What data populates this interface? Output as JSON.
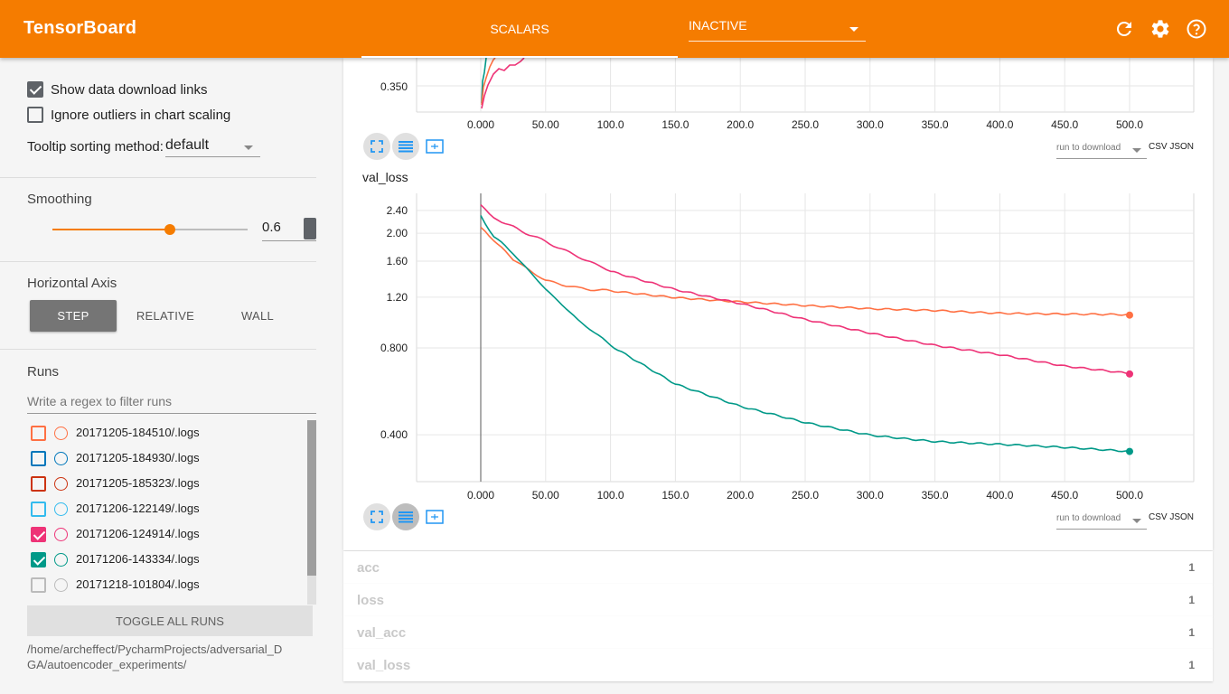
{
  "header": {
    "brand": "TensorBoard",
    "tab_scalars": "SCALARS",
    "inactive_select": "INACTIVE",
    "icons": [
      "refresh-icon",
      "gear-icon",
      "help-icon"
    ]
  },
  "sidebar": {
    "show_download_links": {
      "label": "Show data download links",
      "checked": true
    },
    "ignore_outliers": {
      "label": "Ignore outliers in chart scaling",
      "checked": false
    },
    "tooltip_sorting": {
      "label": "Tooltip sorting method:",
      "value": "default"
    },
    "smoothing": {
      "heading": "Smoothing",
      "value": "0.6",
      "fraction": 0.6
    },
    "horizontal_axis": {
      "heading": "Horizontal Axis",
      "options": [
        "STEP",
        "RELATIVE",
        "WALL"
      ],
      "selected": "STEP"
    },
    "runs": {
      "heading": "Runs",
      "filter_placeholder": "Write a regex to filter runs",
      "items": [
        {
          "name": "20171205-184510/.logs",
          "color": "#ff7043",
          "checked": false
        },
        {
          "name": "20171205-184930/.logs",
          "color": "#0077bb",
          "checked": false
        },
        {
          "name": "20171205-185323/.logs",
          "color": "#cc3311",
          "checked": false
        },
        {
          "name": "20171206-122149/.logs",
          "color": "#33bbee",
          "checked": false
        },
        {
          "name": "20171206-124914/.logs",
          "color": "#ee3377",
          "checked": true
        },
        {
          "name": "20171206-143334/.logs",
          "color": "#009988",
          "checked": true
        },
        {
          "name": "20171218-101804/.logs",
          "color": "#bbbbbb",
          "checked": false
        }
      ],
      "toggle_all": "TOGGLE ALL RUNS",
      "logdir": "/home/archeffect/PycharmProjects/adversarial_DGA/autoencoder_experiments/"
    }
  },
  "charts": {
    "top_partial": {
      "y_tick_visible": "0.350",
      "x_ticks": [
        "0.000",
        "50.00",
        "100.0",
        "150.0",
        "200.0",
        "250.0",
        "300.0",
        "350.0",
        "400.0",
        "450.0",
        "500.0"
      ]
    },
    "download": {
      "run_select_placeholder": "run to download",
      "formats": "CSV JSON"
    }
  },
  "chart_data": {
    "type": "line",
    "title": "val_loss",
    "xlim": [
      0,
      500
    ],
    "x_ticks": [
      "0.000",
      "50.00",
      "100.0",
      "150.0",
      "200.0",
      "250.0",
      "300.0",
      "350.0",
      "400.0",
      "450.0",
      "500.0"
    ],
    "y_ticks": [
      "0.400",
      "0.800",
      "1.20",
      "1.60",
      "2.00",
      "2.40"
    ],
    "y_scale": "log",
    "grid": true,
    "series": [
      {
        "color": "#ff7043",
        "x": [
          0,
          10,
          25,
          50,
          75,
          100,
          150,
          200,
          250,
          300,
          350,
          400,
          450,
          500
        ],
        "y": [
          2.1,
          1.9,
          1.62,
          1.37,
          1.29,
          1.26,
          1.2,
          1.16,
          1.12,
          1.09,
          1.08,
          1.06,
          1.05,
          1.04
        ]
      },
      {
        "color": "#ee3377",
        "x": [
          0,
          10,
          25,
          50,
          75,
          100,
          150,
          200,
          250,
          300,
          350,
          400,
          450,
          500
        ],
        "y": [
          2.5,
          2.25,
          2.1,
          1.87,
          1.66,
          1.48,
          1.28,
          1.14,
          1.0,
          0.9,
          0.82,
          0.76,
          0.69,
          0.65
        ]
      },
      {
        "color": "#009988",
        "x": [
          0,
          10,
          25,
          50,
          75,
          100,
          150,
          200,
          250,
          300,
          350,
          400,
          450,
          500
        ],
        "y": [
          2.3,
          1.95,
          1.7,
          1.28,
          1.0,
          0.82,
          0.6,
          0.5,
          0.44,
          0.4,
          0.38,
          0.37,
          0.36,
          0.35
        ]
      }
    ]
  },
  "groups": [
    {
      "name": "acc",
      "count": "1"
    },
    {
      "name": "loss",
      "count": "1"
    },
    {
      "name": "val_acc",
      "count": "1"
    },
    {
      "name": "val_loss",
      "count": "1"
    }
  ]
}
